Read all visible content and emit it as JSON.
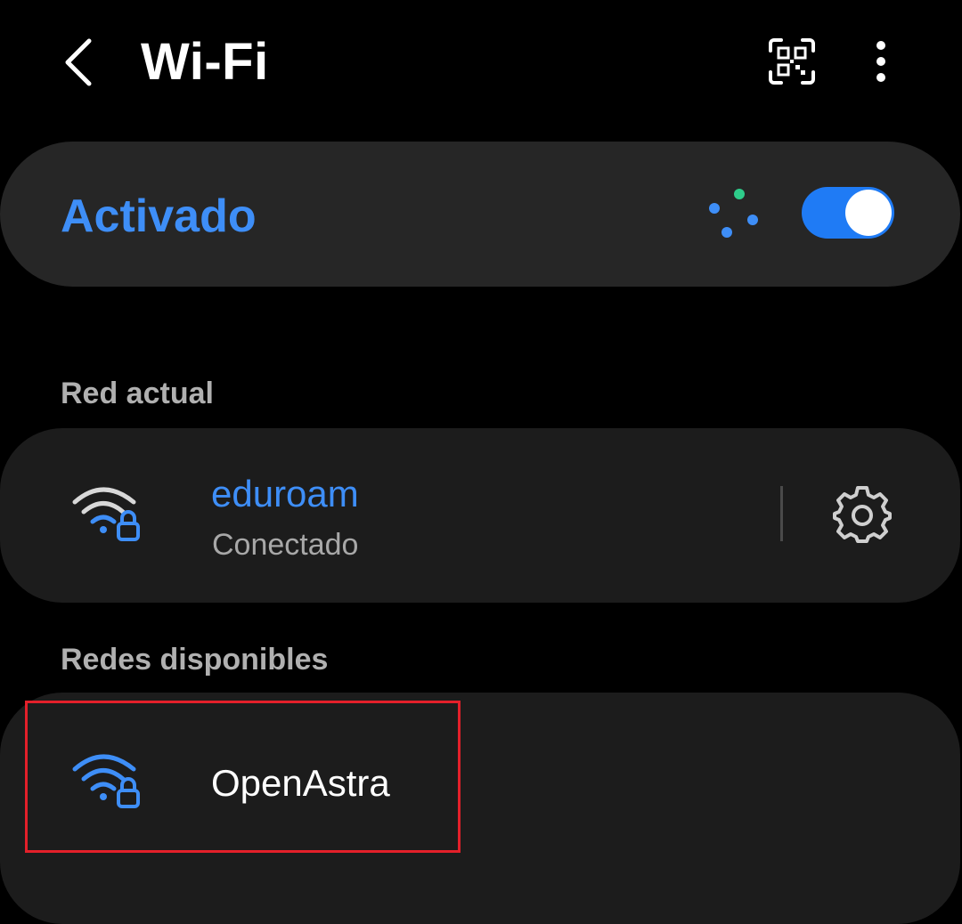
{
  "header": {
    "title": "Wi-Fi",
    "back_icon": "chevron-left-icon",
    "qr_icon": "qr-code-scan-icon",
    "more_icon": "more-vert-icon"
  },
  "master_switch": {
    "label": "Activado",
    "state": "on",
    "scan_indicator_icon": "scanning-dots-icon"
  },
  "current_network": {
    "section_label": "Red actual",
    "name": "eduroam",
    "status": "Conectado",
    "signal_icon": "wifi-locked-icon",
    "settings_icon": "gear-icon"
  },
  "available_networks": {
    "section_label": "Redes disponibles",
    "items": [
      {
        "name": "OpenAstra",
        "signal_icon": "wifi-locked-icon"
      }
    ]
  },
  "colors": {
    "background": "#000000",
    "card": "#262626",
    "card_list": "#1c1c1c",
    "accent": "#3e8ef7",
    "toggle_on": "#1f7bf5",
    "scan_green": "#2ecc8a",
    "highlight": "#e3202a",
    "secondary_text": "#a8a8a8"
  }
}
